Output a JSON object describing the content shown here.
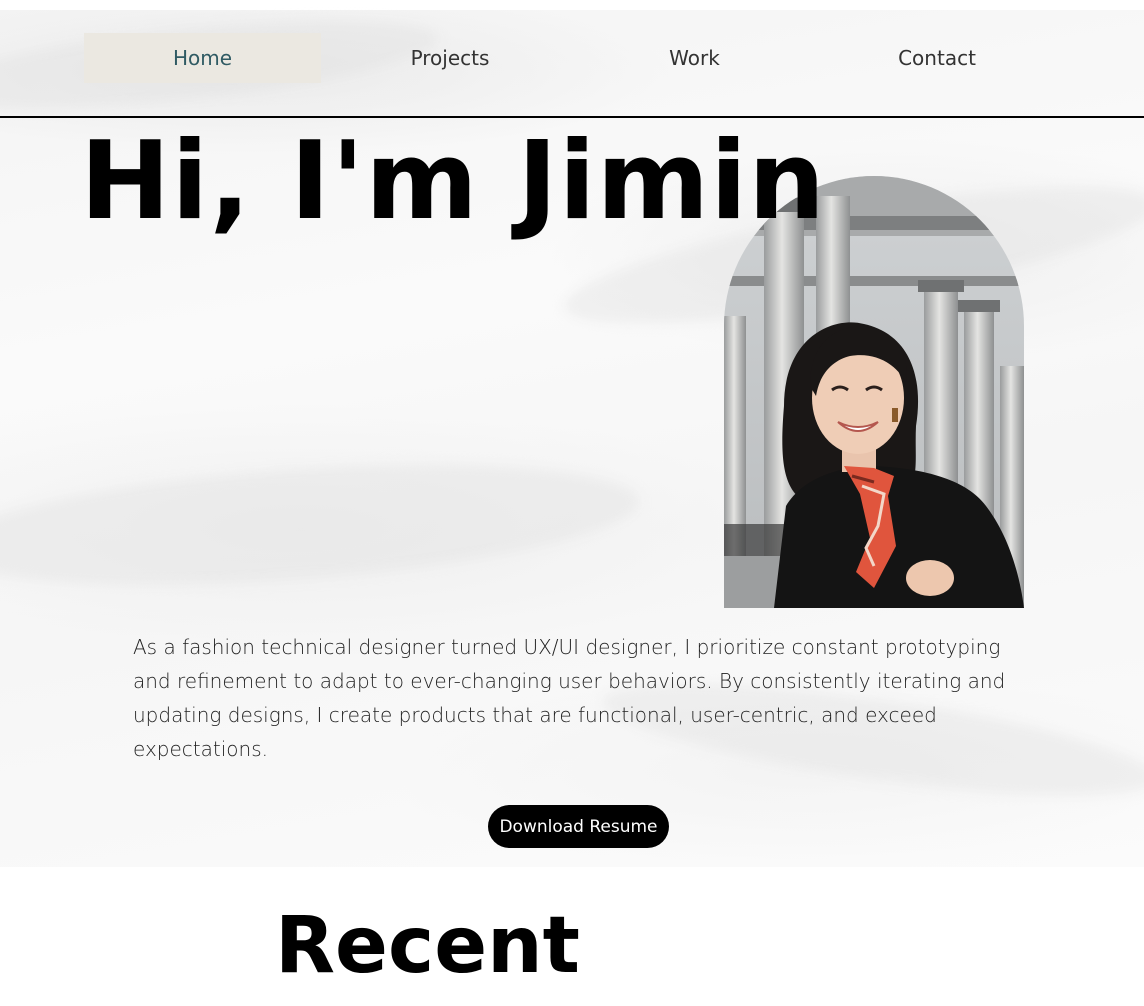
{
  "nav": {
    "items": [
      {
        "label": "Home",
        "active": true
      },
      {
        "label": "Projects",
        "active": false
      },
      {
        "label": "Work",
        "active": false
      },
      {
        "label": "Contact",
        "active": false
      }
    ]
  },
  "hero": {
    "title": "Hi, I'm Jimin",
    "photo_icon": "portrait-photo",
    "bio": "As a fashion technical designer turned UX/UI designer, I prioritize constant prototyping and refinement to adapt to ever-changing user behaviors. By consistently iterating and updating designs, I create products that are functional, user-centric, and exceed expectations.",
    "resume_button": "Download Resume"
  },
  "recent": {
    "title": "Recent"
  },
  "colors": {
    "active_nav_bg": "#ebe8e1",
    "active_nav_text": "#2f5a63",
    "button_bg": "#000000",
    "button_text": "#ffffff"
  }
}
